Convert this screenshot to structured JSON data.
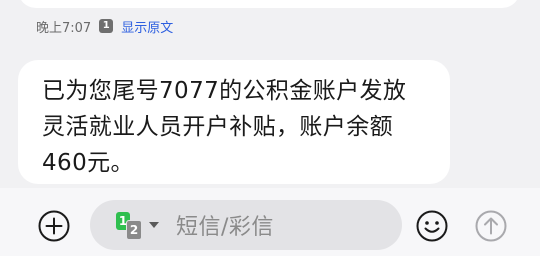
{
  "message": {
    "time": "晚上7:07",
    "sim_badge": "1",
    "show_original_label": "显示原文",
    "text": "已为您尾号7077的公积金账户发放\n灵活就业人员开户补贴，账户余额\n460元。"
  },
  "composer": {
    "sim_primary": "1",
    "sim_secondary": "2",
    "placeholder": "短信/彩信"
  },
  "icons": {
    "add": "plus-circle-icon",
    "emoji": "smiley-icon",
    "send": "send-arrow-up-icon",
    "dropdown": "caret-down-icon"
  },
  "colors": {
    "link": "#2d5fe0",
    "sim_primary": "#2fbf4f",
    "sim_secondary": "#8a8a8a"
  }
}
